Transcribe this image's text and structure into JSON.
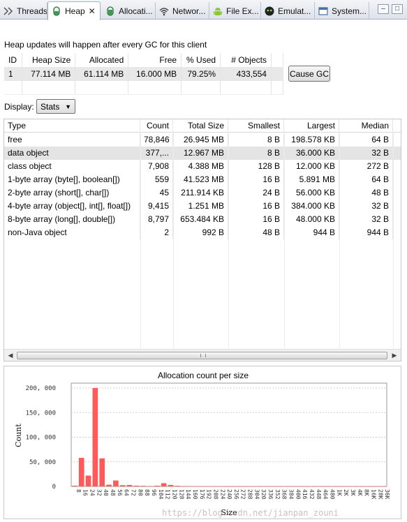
{
  "tabs": [
    {
      "label": "Threads",
      "icon": "threads-icon",
      "active": false
    },
    {
      "label": "Heap",
      "icon": "heap-icon",
      "active": true
    },
    {
      "label": "Allocati...",
      "icon": "allocation-icon",
      "active": false
    },
    {
      "label": "Networ...",
      "icon": "network-icon",
      "active": false
    },
    {
      "label": "File Ex...",
      "icon": "android-icon",
      "active": false
    },
    {
      "label": "Emulat...",
      "icon": "emulator-icon",
      "active": false
    },
    {
      "label": "System...",
      "icon": "window-icon",
      "active": false
    }
  ],
  "window_controls": {
    "minimize": "–",
    "maximize": "□"
  },
  "heap": {
    "note": "Heap updates will happen after every GC for this client",
    "headers": [
      "ID",
      "Heap Size",
      "Allocated",
      "Free",
      "% Used",
      "# Objects"
    ],
    "row": [
      "1",
      "77.114 MB",
      "61.114 MB",
      "16.000 MB",
      "79.25%",
      "433,554"
    ],
    "cause_gc": "Cause GC"
  },
  "display": {
    "label": "Display:",
    "value": "Stats"
  },
  "stats": {
    "headers": [
      "Type",
      "Count",
      "Total Size",
      "Smallest",
      "Largest",
      "Median"
    ],
    "rows": [
      [
        "free",
        "78,846",
        "26.945 MB",
        "8 B",
        "198.578 KB",
        "64 B"
      ],
      [
        "data object",
        "377,...",
        "12.967 MB",
        "8 B",
        "36.000 KB",
        "32 B"
      ],
      [
        "class object",
        "7,908",
        "4.388 MB",
        "128 B",
        "12.000 KB",
        "272 B"
      ],
      [
        "1-byte array (byte[], boolean[])",
        "559",
        "41.523 MB",
        "16 B",
        "5.891 MB",
        "64 B"
      ],
      [
        "2-byte array (short[], char[])",
        "45",
        "211.914 KB",
        "24 B",
        "56.000 KB",
        "48 B"
      ],
      [
        "4-byte array (object[], int[], float[])",
        "9,415",
        "1.251 MB",
        "16 B",
        "384.000 KB",
        "32 B"
      ],
      [
        "8-byte array (long[], double[])",
        "8,797",
        "653.484 KB",
        "16 B",
        "48.000 KB",
        "32 B"
      ],
      [
        "non-Java object",
        "2",
        "992 B",
        "48 B",
        "944 B",
        "944 B"
      ]
    ],
    "selected_row": 1
  },
  "chart_data": {
    "type": "bar",
    "title": "Allocation count per size",
    "xlabel": "Size",
    "ylabel": "Count",
    "ylim": [
      0,
      210000
    ],
    "yticks": [
      0,
      50000,
      100000,
      150000,
      200000
    ],
    "ytick_labels": [
      "0",
      "50, 000",
      "100, 000",
      "150, 000",
      "200, 000"
    ],
    "categories": [
      "8",
      "16",
      "24",
      "32",
      "40",
      "48",
      "56",
      "64",
      "72",
      "80",
      "88",
      "96",
      "104",
      "112",
      "120",
      "128",
      "144",
      "160",
      "176",
      "192",
      "208",
      "224",
      "240",
      "256",
      "272",
      "288",
      "304",
      "320",
      "336",
      "352",
      "368",
      "384",
      "400",
      "416",
      "432",
      "448",
      "464",
      "480",
      "1K",
      "2K",
      "3K",
      "4K",
      "8K",
      "16K",
      "28K",
      "36K"
    ],
    "values": [
      1500,
      58000,
      22000,
      200000,
      57000,
      3500,
      12000,
      2500,
      3000,
      1500,
      1200,
      800,
      1500,
      6500,
      3000,
      1200,
      800,
      500,
      400,
      300,
      300,
      200,
      200,
      300,
      200,
      200,
      200,
      100,
      100,
      100,
      100,
      100,
      100,
      100,
      100,
      100,
      100,
      100,
      200,
      100,
      100,
      100,
      100,
      100,
      100,
      100
    ],
    "bar_color": "#ff5a5a",
    "grid": true
  },
  "watermark": "https://blog.csdn.net/jianpan_zouni"
}
